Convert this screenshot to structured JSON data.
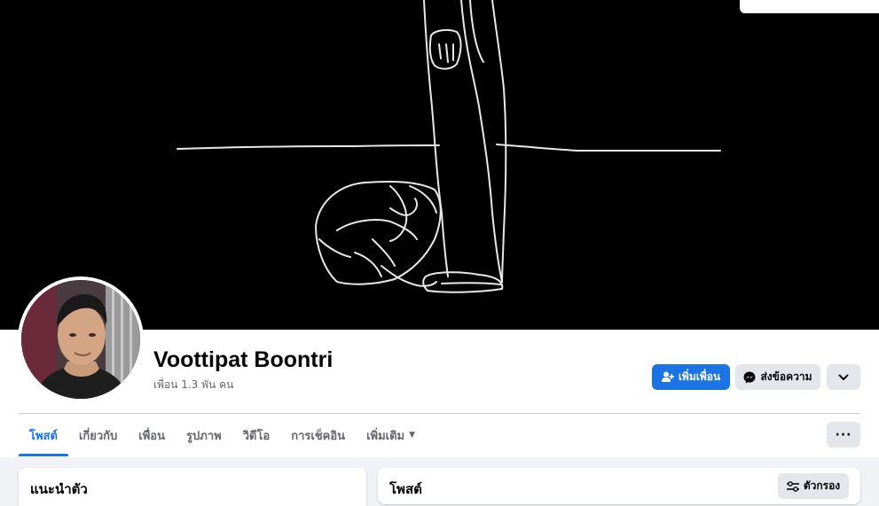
{
  "profile": {
    "name": "Voottipat Boontri",
    "friends_text": "เพื่อน 1.3 พัน คน"
  },
  "actions": {
    "add_friend": "เพิ่มเพื่อน",
    "message": "ส่งข้อความ",
    "more_icon": "chevron-down-icon"
  },
  "tabs": [
    {
      "label": "โพสต์",
      "active": true
    },
    {
      "label": "เกี่ยวกับ",
      "active": false
    },
    {
      "label": "เพื่อน",
      "active": false
    },
    {
      "label": "รูปภาพ",
      "active": false
    },
    {
      "label": "วิดีโอ",
      "active": false
    },
    {
      "label": "การเช็คอิน",
      "active": false
    },
    {
      "label": "เพิ่มเติม",
      "active": false
    }
  ],
  "tab_more_button": "···",
  "intro": {
    "title": "แนะนำตัว"
  },
  "posts": {
    "title": "โพสต์",
    "filter_label": "ตัวกรอง"
  },
  "colors": {
    "accent": "#1b74e4",
    "button_gray": "#e4e6eb",
    "cover_background": "#000000"
  }
}
